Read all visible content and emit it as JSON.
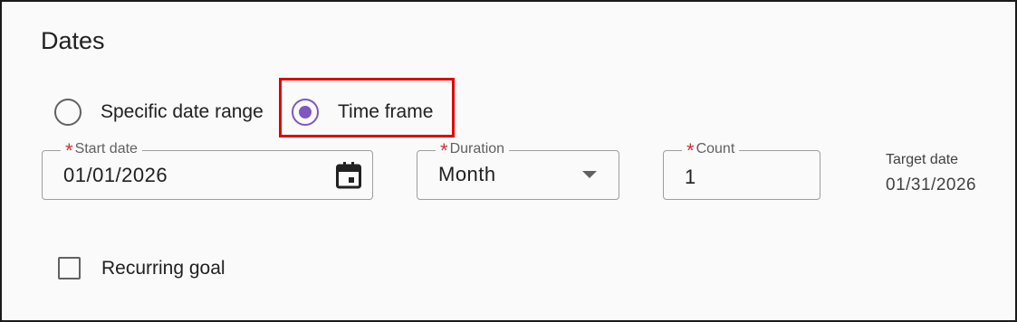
{
  "section": {
    "title": "Dates"
  },
  "date_mode": {
    "options": [
      {
        "label": "Specific date range",
        "selected": false
      },
      {
        "label": "Time frame",
        "selected": true
      }
    ]
  },
  "fields": {
    "start_date": {
      "label": "Start date",
      "value": "01/01/2026",
      "required": true,
      "icon": "calendar-icon"
    },
    "duration": {
      "label": "Duration",
      "value": "Month",
      "required": true,
      "icon": "chevron-down-icon"
    },
    "count": {
      "label": "Count",
      "value": "1",
      "required": true
    }
  },
  "target_date": {
    "label": "Target date",
    "value": "01/31/2026"
  },
  "recurring": {
    "label": "Recurring goal",
    "checked": false
  },
  "colors": {
    "accent": "#7e57c2",
    "required": "#d32f2f",
    "highlight": "#e00000"
  }
}
